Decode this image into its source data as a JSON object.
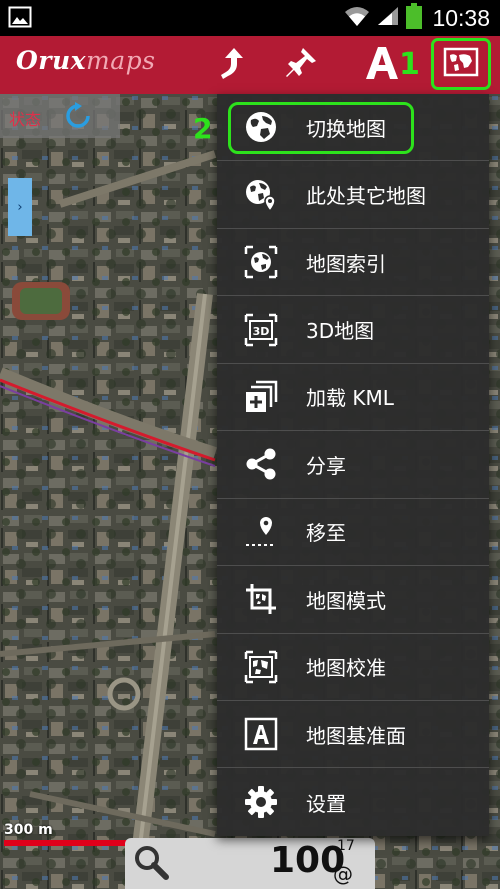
{
  "status_bar": {
    "time": "10:38",
    "icons": [
      "gallery-icon",
      "wifi-icon",
      "signal-icon",
      "battery-icon"
    ]
  },
  "action_bar": {
    "brand_part1": "Orux",
    "brand_part2": "maps",
    "buttons": [
      "turn-up-icon",
      "pushpin-icon",
      "text-size-icon",
      "map-switch-icon"
    ],
    "marker_1": "1",
    "accent_color": "#b31b34"
  },
  "map": {
    "status_label": "状态",
    "scale_label": "300 m"
  },
  "bottom_panel": {
    "value": "100",
    "superscript": "17",
    "unit": "@"
  },
  "menu": {
    "marker_2": "2",
    "highlight_color": "#2de21c",
    "items": [
      {
        "label": "切换地图",
        "icon": "globe-icon"
      },
      {
        "label": "此处其它地图",
        "icon": "globe-pin-icon"
      },
      {
        "label": "地图索引",
        "icon": "globe-frame-icon"
      },
      {
        "label": "3D地图",
        "icon": "3d-icon"
      },
      {
        "label": "加载 KML",
        "icon": "add-layers-icon"
      },
      {
        "label": "分享",
        "icon": "share-icon"
      },
      {
        "label": "移至",
        "icon": "move-to-pin-icon"
      },
      {
        "label": "地图模式",
        "icon": "crop-map-icon"
      },
      {
        "label": "地图校准",
        "icon": "calibrate-map-icon"
      },
      {
        "label": "地图基准面",
        "icon": "datum-a-icon"
      },
      {
        "label": "设置",
        "icon": "gear-icon"
      }
    ]
  }
}
